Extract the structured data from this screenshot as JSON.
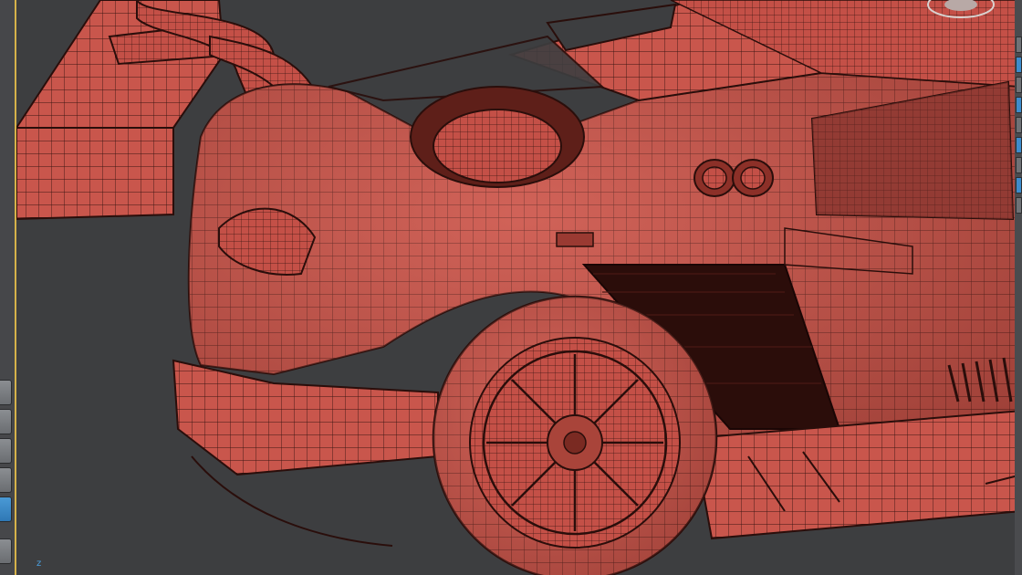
{
  "viewport": {
    "axis_z_label": "z",
    "model_color": "#c9564c",
    "wire_color": "#3a1512",
    "background_color": "#3d3e40",
    "frame_accent": "#d6b24a",
    "selected_button_color": "#3d8ccc"
  },
  "toolbars": {
    "left_buttons": [
      "button",
      "button",
      "button",
      "button",
      "button-active",
      "button"
    ],
    "right_buttons": [
      "button",
      "button-active",
      "button",
      "button-active",
      "button",
      "button-active",
      "button",
      "button-active",
      "button"
    ]
  },
  "icons": {
    "view_cube": "view-cube-icon",
    "axis_gizmo": "axis-gizmo-icon"
  }
}
